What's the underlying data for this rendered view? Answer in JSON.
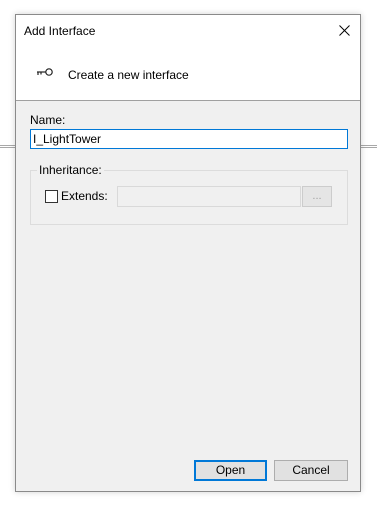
{
  "window": {
    "title": "Add Interface",
    "close_icon": "close-icon"
  },
  "header": {
    "icon": "key-icon",
    "text": "Create a new interface"
  },
  "form": {
    "name_label": "Name:",
    "name_value": "I_LightTower",
    "inheritance_label": "Inheritance:",
    "extends_label": "Extends:",
    "extends_checked": false,
    "extends_value": "",
    "browse_label": "..."
  },
  "buttons": {
    "open_label": "Open",
    "cancel_label": "Cancel"
  },
  "colors": {
    "accent": "#0078d7",
    "dialog_bg": "#f0f0f0",
    "header_bg": "#ffffff"
  }
}
